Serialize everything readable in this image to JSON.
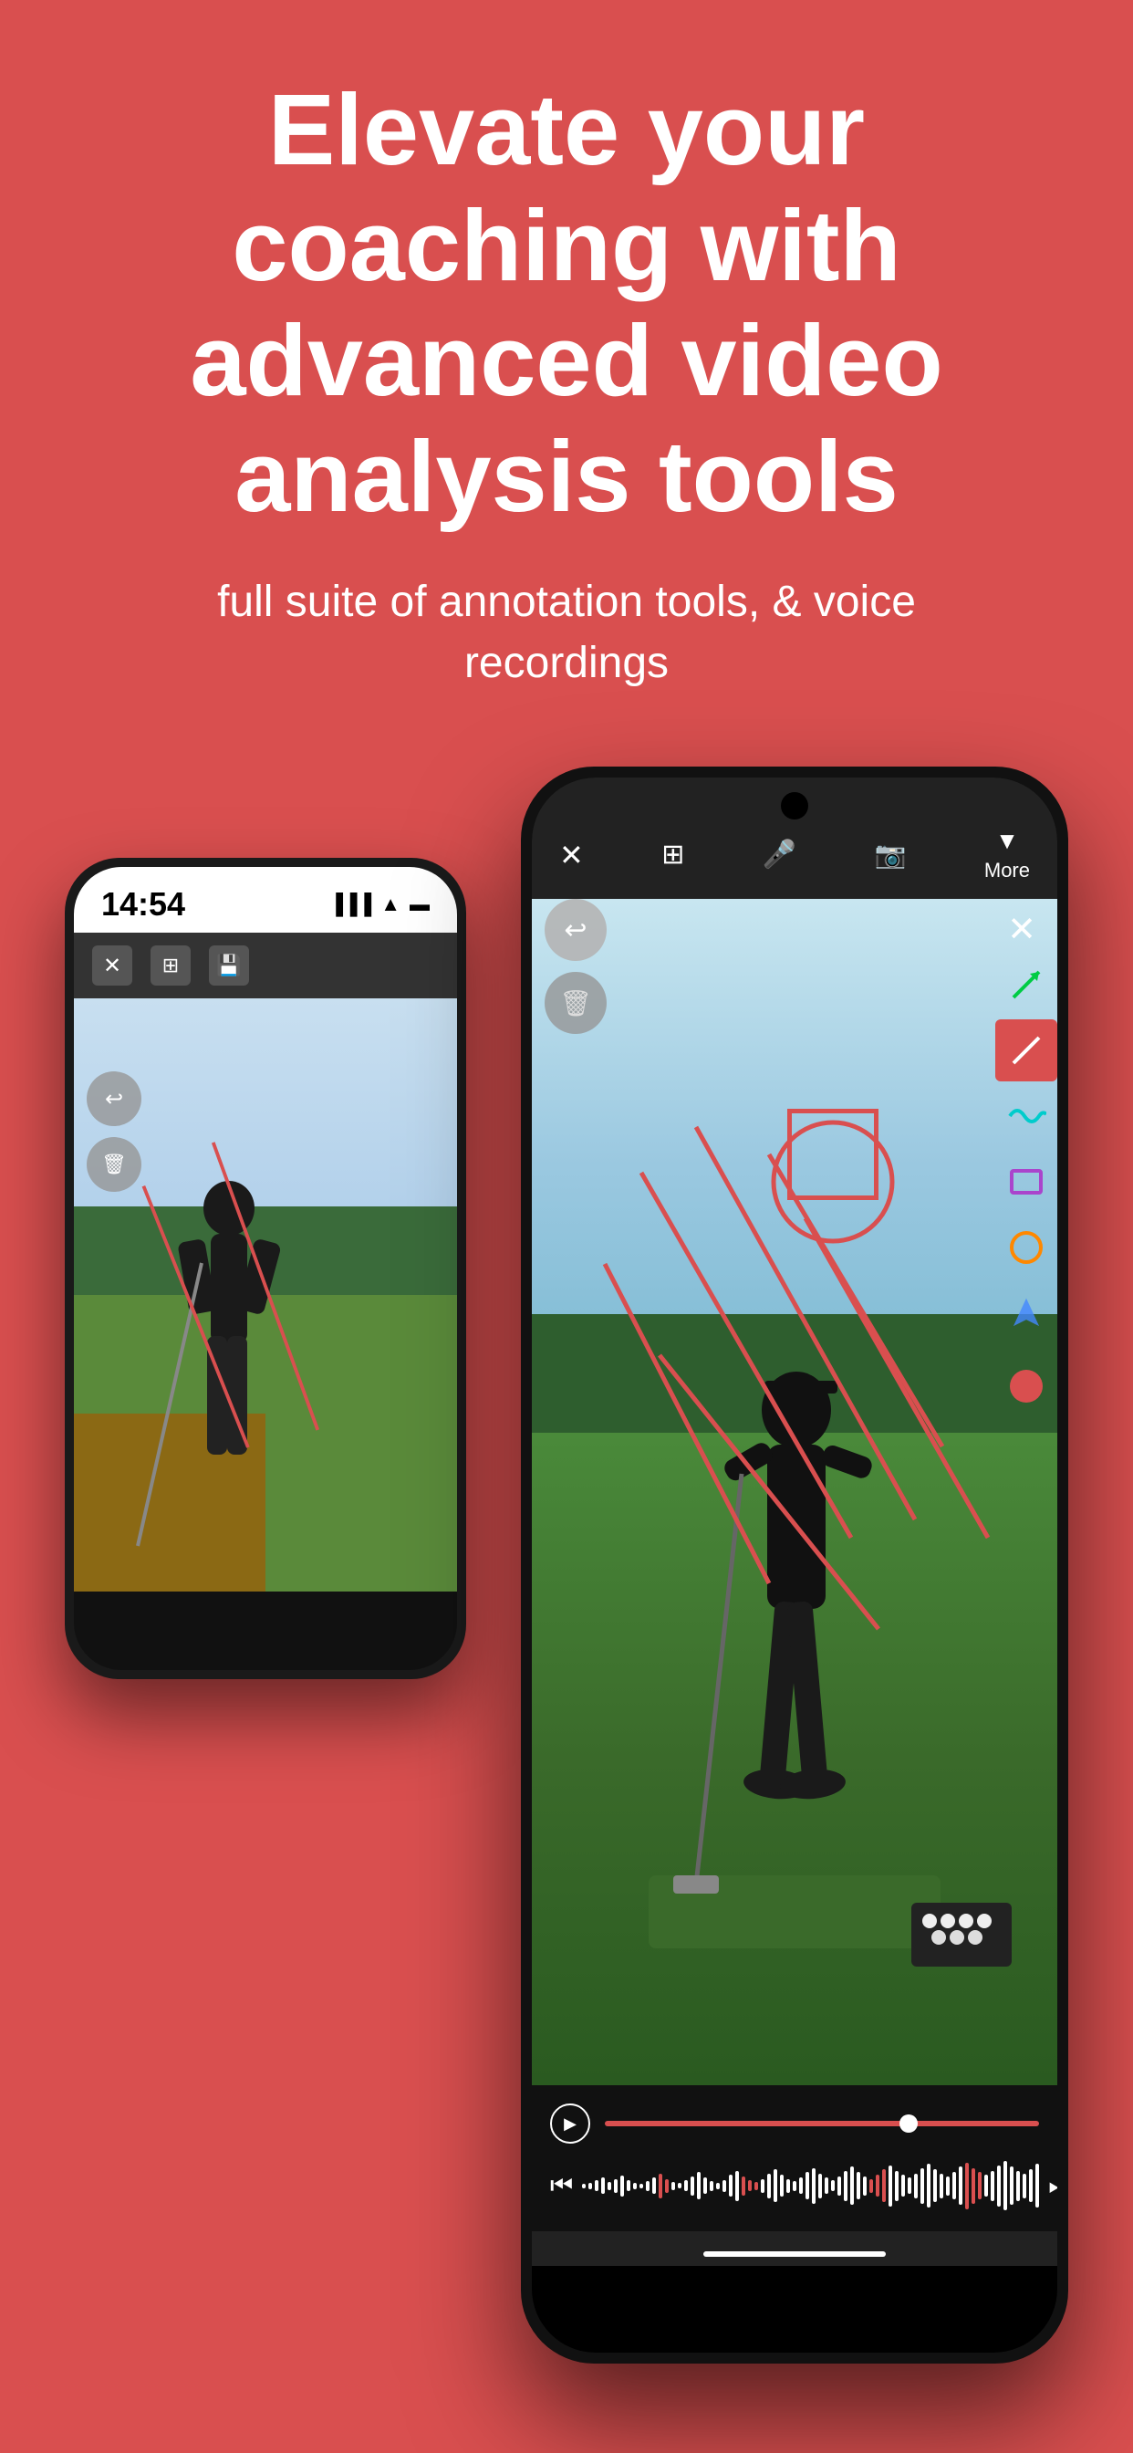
{
  "page": {
    "background_color": "#D94F4F"
  },
  "hero": {
    "title": "Elevate your coaching with advanced video analysis tools",
    "subtitle": "full suite of annotation tools, & voice recordings"
  },
  "phone_back": {
    "status_time": "14:54",
    "toolbar": {
      "close_label": "✕",
      "split_label": "⊞",
      "save_label": "💾"
    }
  },
  "phone_front": {
    "toolbar": {
      "close_label": "✕",
      "split_label": "⊞",
      "mic_label": "🎤",
      "camera_label": "📷",
      "more_label": "More"
    },
    "annotation_tools": {
      "undo_icon": "↩",
      "delete_icon": "🗑",
      "close_icon": "✕",
      "arrow_green": "↗",
      "line_red": "/",
      "squiggle_teal": "~",
      "rectangle_purple": "□",
      "circle_orange": "○",
      "fill_blue": "✦",
      "record_red": "●"
    },
    "video_controls": {
      "play_icon": "▶",
      "skip_back_icon": "⏮",
      "skip_forward_icon": "⏭"
    }
  },
  "waveform_bars": [
    3,
    5,
    8,
    12,
    6,
    10,
    15,
    8,
    5,
    3,
    7,
    12,
    18,
    10,
    6,
    4,
    8,
    14,
    20,
    12,
    7,
    5,
    9,
    16,
    22,
    14,
    8,
    6,
    10,
    18,
    24,
    16,
    10,
    7,
    12,
    20,
    26,
    18,
    12,
    8,
    14,
    22,
    28,
    20,
    14,
    10,
    16,
    24,
    30,
    22,
    16,
    12,
    18,
    26,
    32,
    24,
    18,
    14,
    20,
    28,
    34,
    26,
    20,
    16,
    22,
    30,
    36,
    28,
    22,
    18,
    24,
    32
  ]
}
